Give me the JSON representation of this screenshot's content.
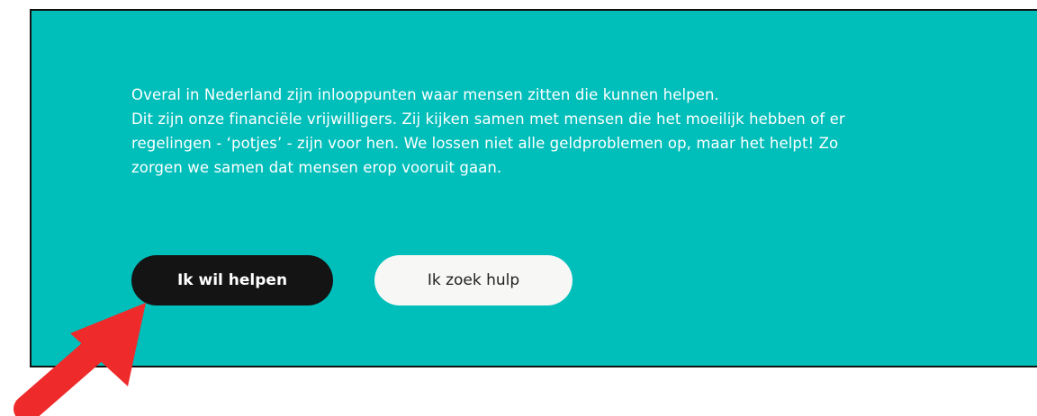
{
  "colors": {
    "panel_background": "#00bfbb",
    "panel_border": "#111111",
    "text": "#ffffff",
    "primary_button": "#141414",
    "secondary_button": "#f7f7f5",
    "annotation_arrow": "#ee2a2a"
  },
  "intro": {
    "lines": [
      "Overal in Nederland zijn inlooppunten waar mensen zitten die kunnen helpen.",
      "Dit zijn onze financiële vrijwilligers. Zij kijken samen met mensen die het moeilijk hebben of er",
      "regelingen - ‘potjes’ - zijn voor hen. We lossen niet alle geldproblemen op, maar het helpt! Zo",
      "zorgen we samen dat mensen erop vooruit gaan."
    ]
  },
  "buttons": {
    "help_label": "Ik wil helpen",
    "seek_help_label": "Ik zoek hulp"
  },
  "annotation": {
    "icon": "red-arrow-icon",
    "points_to": "help-button"
  }
}
